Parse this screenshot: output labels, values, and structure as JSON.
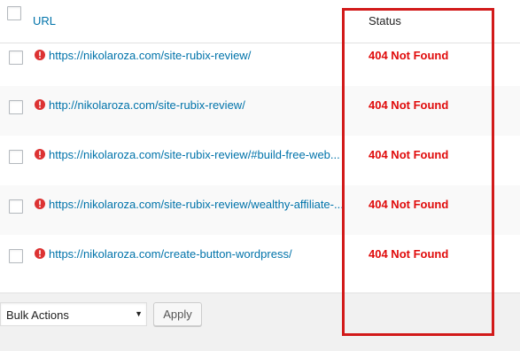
{
  "table": {
    "columns": {
      "url": "URL",
      "status": "Status"
    },
    "rows": [
      {
        "url": "https://nikolaroza.com/site-rubix-review/",
        "status": "404 Not Found"
      },
      {
        "url": "http://nikolaroza.com/site-rubix-review/",
        "status": "404 Not Found"
      },
      {
        "url": "https://nikolaroza.com/site-rubix-review/#build-free-web...",
        "status": "404 Not Found"
      },
      {
        "url": "https://nikolaroza.com/site-rubix-review/wealthy-affiliate-...",
        "status": "404 Not Found"
      },
      {
        "url": "https://nikolaroza.com/create-button-wordpress/",
        "status": "404 Not Found"
      }
    ]
  },
  "footer": {
    "bulk_actions": "Bulk Actions",
    "bulk_arrow": "▼",
    "apply_label": "Apply"
  },
  "colors": {
    "link": "#0073aa",
    "status_error": "#e00b0b",
    "highlight": "#d21a1a"
  },
  "icons": {
    "row_icon": "alert-circle-icon"
  }
}
